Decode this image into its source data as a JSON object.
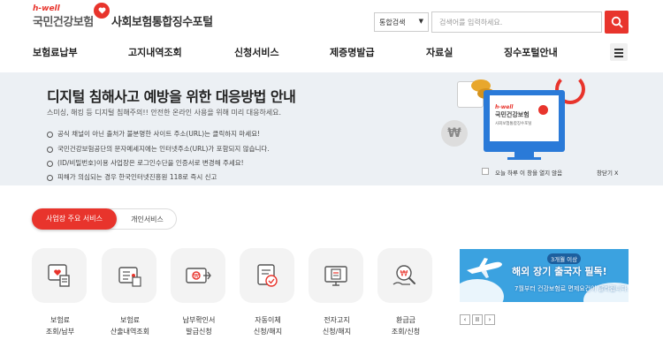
{
  "header": {
    "logo_brand": "h-well",
    "logo_name": "국민건강보험",
    "portal_title": "사회보험통합징수포털",
    "search": {
      "select_value": "통합검색",
      "placeholder": "검색어를 입력하세요."
    }
  },
  "nav": {
    "items": [
      "보험료납부",
      "고지내역조회",
      "신청서비스",
      "제증명발급",
      "자료실",
      "징수포털안내"
    ]
  },
  "banner": {
    "title": "디지털 침해사고 예방을 위한 대응방법 안내",
    "subtitle": "스미싱, 해킹 등 디지털 침해주의!! 안전한 온라인 사용을 위해 미리 대응하세요.",
    "tips": [
      "공식 채널이 아닌 출처가 불분명한 사이트 주소(URL)는 클릭하지 마세요!",
      "국민건강보험공단의 문자메세지에는 인터넷주소(URL)가 포함되지 않습니다.",
      "(ID/비밀번호)이용 사업장은 로그인수단을 인증서로 변경해 주세요!",
      "피해가 의심되는 경우 한국인터넷진흥원 118로 즉시 신고"
    ],
    "monitor_brand": "h-well",
    "monitor_name": "국민건강보험",
    "monitor_sub": "사회보험통합징수포털",
    "coin_symbol": "₩",
    "no_show_today": "오늘 하루 이 창을 열지 않음",
    "close_label": "창닫기 X"
  },
  "tabs": {
    "active": "사업장 주요 서비스",
    "inactive": "개인서비스"
  },
  "services": [
    {
      "line1": "보험료",
      "line2": "조회/납부",
      "icon": "document-heart-icon"
    },
    {
      "line1": "보험료",
      "line2": "산출내역조회",
      "icon": "calculator-list-icon"
    },
    {
      "line1": "납부확인서",
      "line2": "발급신청",
      "icon": "payment-certificate-icon"
    },
    {
      "line1": "자동이체",
      "line2": "신청/해지",
      "icon": "auto-transfer-icon"
    },
    {
      "line1": "전자고지",
      "line2": "신청/해지",
      "icon": "e-notice-monitor-icon"
    },
    {
      "line1": "환급금",
      "line2": "조회/신청",
      "icon": "refund-search-icon"
    }
  ],
  "ad": {
    "small": "3개월 이상",
    "big": "해외 장기 출국자 필독!",
    "foot": "7월부터 건강보험료 면제요건이 달라집니다."
  },
  "ad_controls": [
    "‹",
    "II",
    "›"
  ],
  "colors": {
    "accent": "#e8342c",
    "banner_bg": "#ecf0f4",
    "monitor": "#2a7ad8",
    "ad_bg": "#3ba2e0"
  }
}
